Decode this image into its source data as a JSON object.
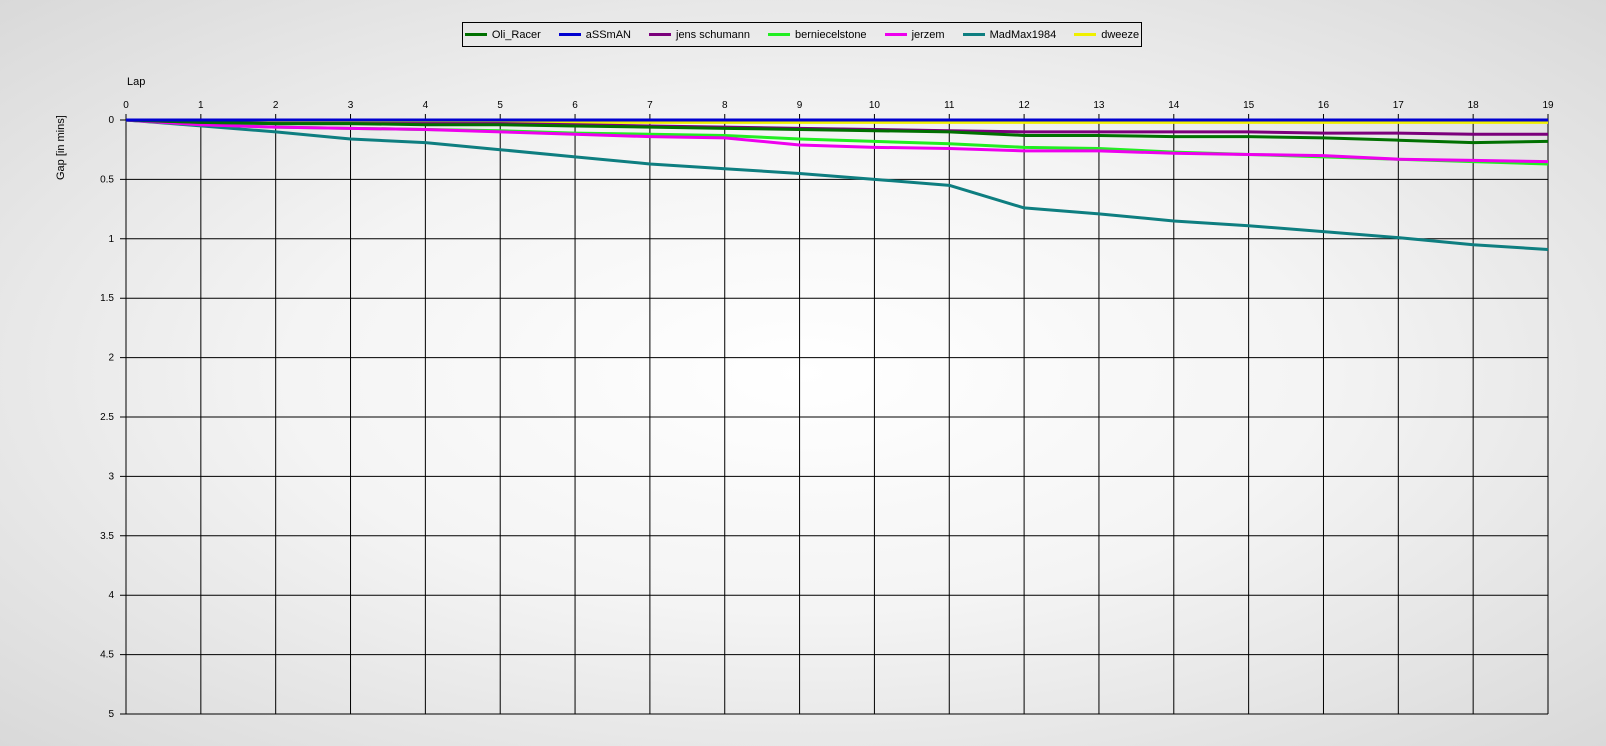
{
  "chart_data": {
    "type": "line",
    "title": "",
    "xlabel": "Lap",
    "ylabel": "Gap [in mins]",
    "x": [
      0,
      1,
      2,
      3,
      4,
      5,
      6,
      7,
      8,
      9,
      10,
      11,
      12,
      13,
      14,
      15,
      16,
      17,
      18,
      19
    ],
    "xlim": [
      0,
      19
    ],
    "ylim": [
      0,
      5
    ],
    "y_inverted": true,
    "x_axis_position": "top",
    "yticks": [
      "0",
      "0.5",
      "1",
      "1.5",
      "2",
      "2.5",
      "3",
      "3.5",
      "4",
      "4.5",
      "5"
    ],
    "xticks": [
      "0",
      "1",
      "2",
      "3",
      "4",
      "5",
      "6",
      "7",
      "8",
      "9",
      "10",
      "11",
      "12",
      "13",
      "14",
      "15",
      "16",
      "17",
      "18",
      "19"
    ],
    "grid": true,
    "legend_position": "top-center",
    "series": [
      {
        "name": "Oli_Racer",
        "color": "#007000",
        "values": [
          0,
          0.02,
          0.03,
          0.03,
          0.04,
          0.04,
          0.05,
          0.06,
          0.07,
          0.08,
          0.09,
          0.1,
          0.13,
          0.13,
          0.14,
          0.14,
          0.15,
          0.17,
          0.19,
          0.18
        ]
      },
      {
        "name": "aSSmAN",
        "color": "#0000d0",
        "values": [
          0,
          0,
          0,
          0,
          0,
          0,
          0,
          0,
          0,
          0,
          0,
          0,
          0,
          0,
          0,
          0,
          0,
          0,
          0,
          0
        ]
      },
      {
        "name": "jens  schumann",
        "color": "#7b007b",
        "values": [
          0,
          0.02,
          0.03,
          0.03,
          0.03,
          0.03,
          0.04,
          0.05,
          0.06,
          0.07,
          0.08,
          0.09,
          0.1,
          0.1,
          0.1,
          0.1,
          0.11,
          0.11,
          0.12,
          0.12
        ]
      },
      {
        "name": "berniecelstone",
        "color": "#22ee22",
        "values": [
          0,
          0.04,
          0.06,
          0.07,
          0.08,
          0.09,
          0.11,
          0.12,
          0.13,
          0.16,
          0.18,
          0.2,
          0.23,
          0.24,
          0.27,
          0.29,
          0.31,
          0.33,
          0.35,
          0.37
        ]
      },
      {
        "name": "jerzem",
        "color": "#ee00ee",
        "values": [
          0,
          0.04,
          0.06,
          0.07,
          0.08,
          0.1,
          0.12,
          0.14,
          0.15,
          0.21,
          0.23,
          0.24,
          0.26,
          0.26,
          0.28,
          0.29,
          0.3,
          0.33,
          0.34,
          0.35
        ]
      },
      {
        "name": "MadMax1984",
        "color": "#0e7e80",
        "values": [
          0,
          0.05,
          0.1,
          0.16,
          0.19,
          0.25,
          0.31,
          0.37,
          0.41,
          0.45,
          0.5,
          0.55,
          0.74,
          0.79,
          0.85,
          0.89,
          0.94,
          0.99,
          1.05,
          1.09
        ]
      },
      {
        "name": "dweeze",
        "color": "#f0f000",
        "values": [
          0,
          0.02,
          0.02,
          0.02,
          0.02,
          0.02,
          0.02,
          0.02,
          0.02,
          0.02,
          0.02,
          0.02,
          0.02,
          0.02,
          0.02,
          0.02,
          0.02,
          0.02,
          0.02,
          0.02
        ]
      }
    ]
  }
}
